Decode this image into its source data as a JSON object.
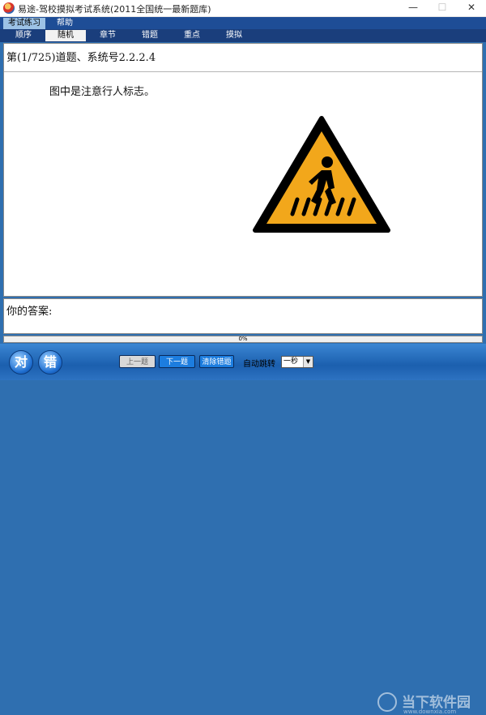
{
  "window": {
    "title": "易途-驾校摸拟考试系统(2011全国统一最新题库)",
    "min_symbol": "—",
    "max_symbol": "☐",
    "close_symbol": "✕"
  },
  "menu": {
    "exam": "考试练习",
    "help": "帮助"
  },
  "tabs": [
    {
      "label": "顺序"
    },
    {
      "label": "随机"
    },
    {
      "label": "章节"
    },
    {
      "label": "错题"
    },
    {
      "label": "重点"
    },
    {
      "label": "摸拟"
    }
  ],
  "question": {
    "header": "第(1/725)道题、系统号2.2.2.4",
    "text": "图中是注意行人标志。",
    "image": "pedestrian-warning-sign"
  },
  "answer": {
    "label": "你的答案:"
  },
  "progress": {
    "text": "0%",
    "fraction": 0
  },
  "buttons": {
    "right": "对",
    "wrong": "错",
    "prev": "上一题",
    "next": "下一题",
    "clear": "清除错题",
    "auto_jump_label": "自动跳转",
    "auto_jump_value": "一秒",
    "dropdown_arrow": "▼"
  },
  "watermark": {
    "text": "当下软件园",
    "sub": "www.downxia.com"
  },
  "colors": {
    "sign_fill": "#f2a71b",
    "accent": "#1c7ddf"
  }
}
